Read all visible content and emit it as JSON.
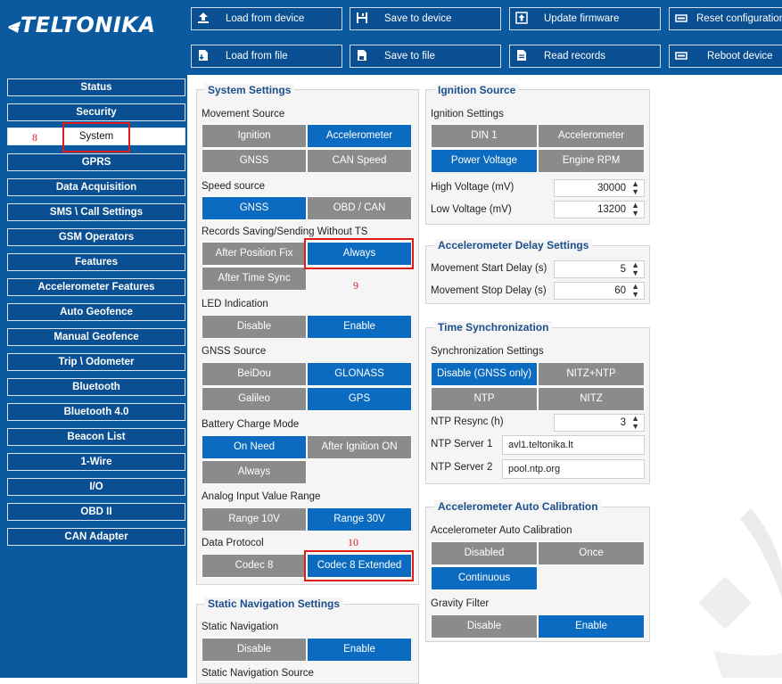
{
  "logo": {
    "text": "TELTONIKA"
  },
  "toolbar": {
    "buttons": [
      {
        "label": "Load from device"
      },
      {
        "label": "Save to device"
      },
      {
        "label": "Update firmware"
      },
      {
        "label": "Reset configuration"
      },
      {
        "label": "Load from file"
      },
      {
        "label": "Save to file"
      },
      {
        "label": "Read records"
      },
      {
        "label": "Reboot device"
      }
    ]
  },
  "sidebar": {
    "items": [
      {
        "label": "Status"
      },
      {
        "label": "Security"
      },
      {
        "label": "System"
      },
      {
        "label": "GPRS"
      },
      {
        "label": "Data Acquisition"
      },
      {
        "label": "SMS \\ Call Settings"
      },
      {
        "label": "GSM Operators"
      },
      {
        "label": "Features"
      },
      {
        "label": "Accelerometer Features"
      },
      {
        "label": "Auto Geofence"
      },
      {
        "label": "Manual Geofence"
      },
      {
        "label": "Trip \\ Odometer"
      },
      {
        "label": "Bluetooth"
      },
      {
        "label": "Bluetooth 4.0"
      },
      {
        "label": "Beacon List"
      },
      {
        "label": "1-Wire"
      },
      {
        "label": "I/O"
      },
      {
        "label": "OBD II"
      },
      {
        "label": "CAN Adapter"
      }
    ]
  },
  "system_settings": {
    "title": "System Settings",
    "movement_source": {
      "label": "Movement Source",
      "options": [
        "Ignition",
        "Accelerometer",
        "GNSS",
        "CAN Speed"
      ]
    },
    "speed_source": {
      "label": "Speed source",
      "options": [
        "GNSS",
        "OBD / CAN"
      ]
    },
    "records_saving": {
      "label": "Records Saving/Sending Without TS",
      "options": [
        "After Position Fix",
        "Always",
        "After Time Sync"
      ]
    },
    "led_indication": {
      "label": "LED Indication",
      "options": [
        "Disable",
        "Enable"
      ]
    },
    "gnss_source": {
      "label": "GNSS Source",
      "options": [
        "BeiDou",
        "GLONASS",
        "Galileo",
        "GPS"
      ]
    },
    "battery_charge": {
      "label": "Battery Charge Mode",
      "options": [
        "On Need",
        "After Ignition ON",
        "Always"
      ]
    },
    "analog_range": {
      "label": "Analog Input Value Range",
      "options": [
        "Range 10V",
        "Range 30V"
      ]
    },
    "data_protocol": {
      "label": "Data Protocol",
      "options": [
        "Codec 8",
        "Codec 8 Extended"
      ]
    }
  },
  "static_navigation": {
    "title": "Static Navigation Settings",
    "static_nav": {
      "label": "Static Navigation",
      "options": [
        "Disable",
        "Enable"
      ]
    },
    "source_label": "Static Navigation Source"
  },
  "ignition_source": {
    "title": "Ignition Source",
    "settings_label": "Ignition Settings",
    "options": [
      "DIN 1",
      "Accelerometer",
      "Power Voltage",
      "Engine RPM"
    ],
    "high_voltage": {
      "label": "High Voltage (mV)",
      "value": "30000"
    },
    "low_voltage": {
      "label": "Low Voltage (mV)",
      "value": "13200"
    }
  },
  "accel_delay": {
    "title": "Accelerometer Delay Settings",
    "start": {
      "label": "Movement Start Delay (s)",
      "value": "5"
    },
    "stop": {
      "label": "Movement Stop Delay (s)",
      "value": "60"
    }
  },
  "time_sync": {
    "title": "Time Synchronization",
    "settings_label": "Synchronization Settings",
    "options": [
      "Disable (GNSS only)",
      "NITZ+NTP",
      "NTP",
      "NITZ"
    ],
    "resync": {
      "label": "NTP Resync (h)",
      "value": "3"
    },
    "server1": {
      "label": "NTP Server 1",
      "value": "avl1.teltonika.lt"
    },
    "server2": {
      "label": "NTP Server 2",
      "value": "pool.ntp.org"
    }
  },
  "accel_auto_cal": {
    "title": "Accelerometer Auto Calibration",
    "cal_label": "Accelerometer Auto Calibration",
    "cal_options": [
      "Disabled",
      "Once",
      "Continuous"
    ],
    "gravity_label": "Gravity Filter",
    "gravity_options": [
      "Disable",
      "Enable"
    ]
  },
  "annotations": {
    "n8": "8",
    "n9": "9",
    "n10": "10"
  },
  "colors": {
    "brand_blue": "#0b5aa0",
    "selected": "#0b6bc0",
    "unselected": "#8b8b8b",
    "title_blue": "#1b4f8c",
    "annotation_red": "#e01b1b"
  }
}
